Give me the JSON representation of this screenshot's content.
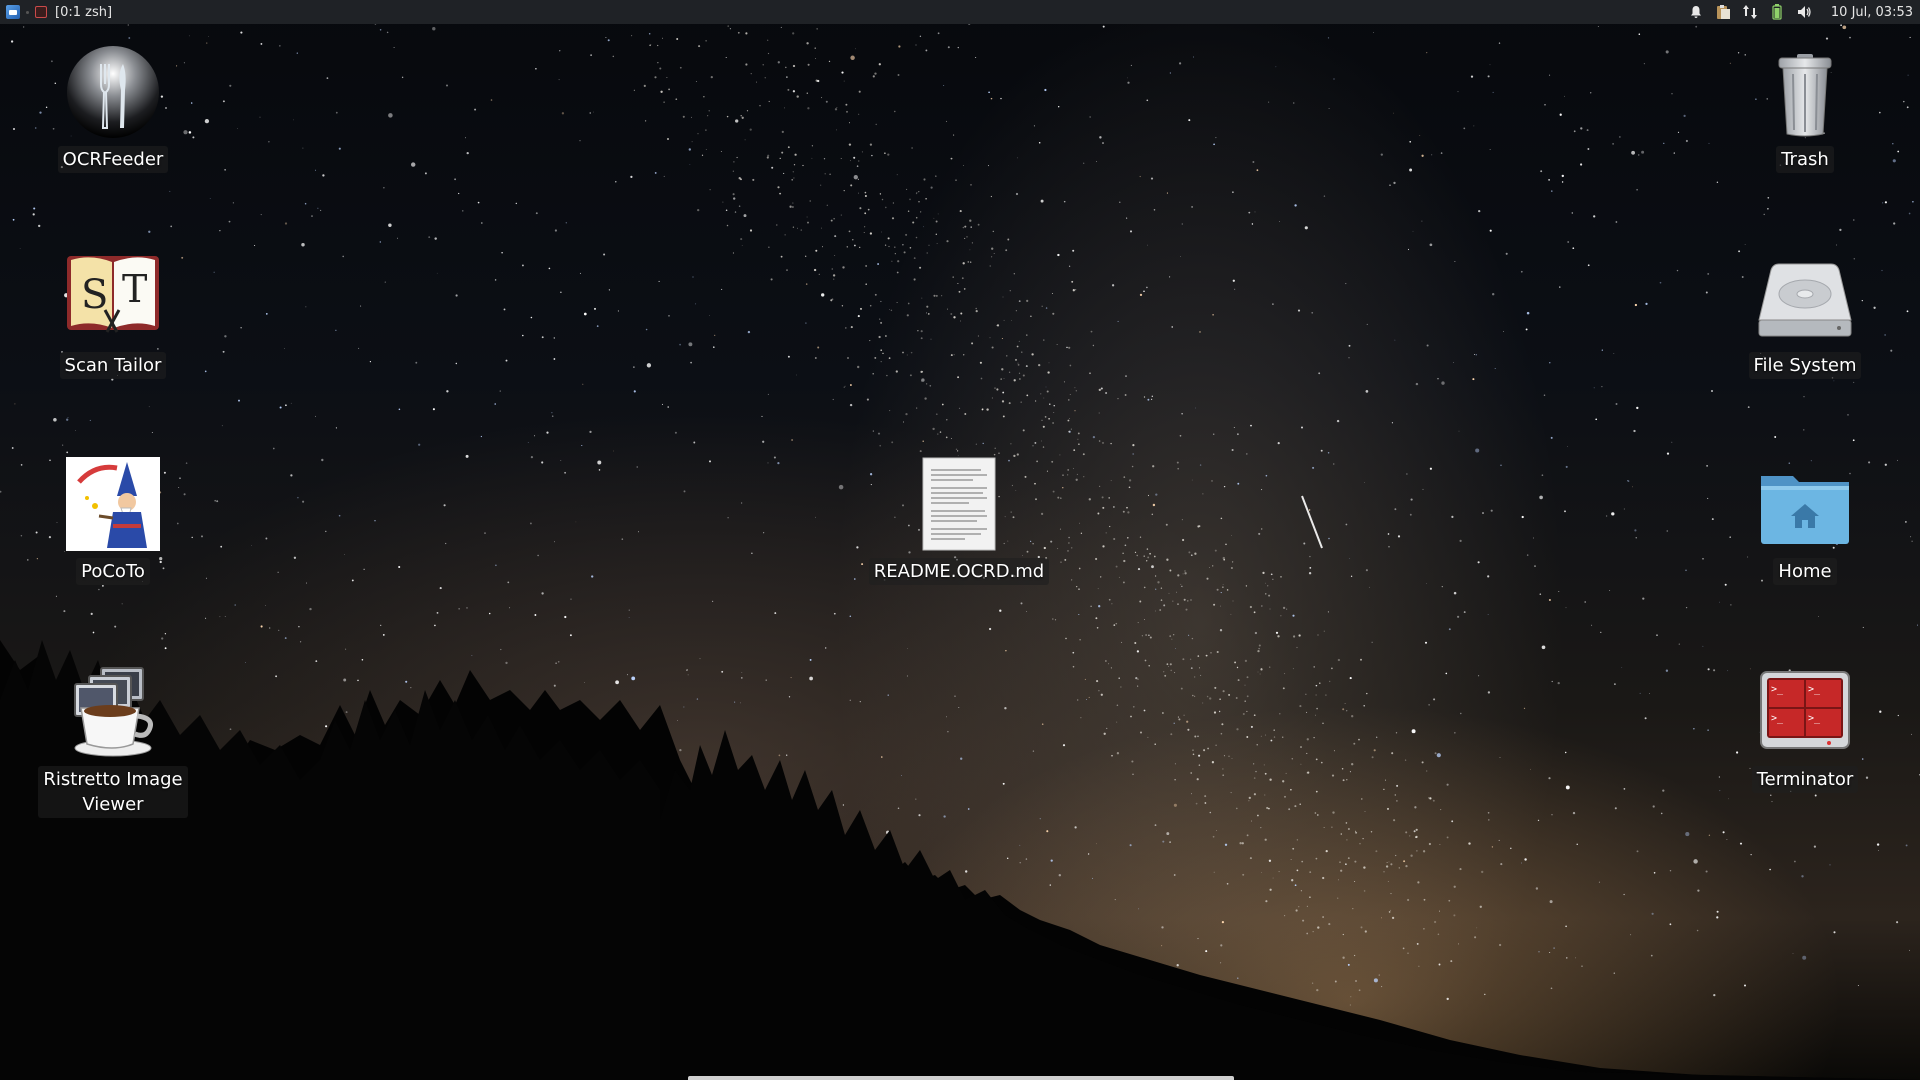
{
  "panel": {
    "menu_icon": "whisker-menu-icon",
    "task_icon": "terminal-task-icon",
    "task_label": "[0:1 zsh]",
    "tray_icons": [
      "bell-icon",
      "clipboard-icon",
      "network-arrows-icon",
      "battery-icon",
      "volume-icon"
    ],
    "clock": "10 Jul, 03:53"
  },
  "desktop": {
    "left_icons": [
      {
        "label": "OCRFeeder",
        "icon": "ocrfeeder-icon"
      },
      {
        "label": "Scan Tailor",
        "icon": "scan-tailor-icon"
      },
      {
        "label": "PoCoTo",
        "icon": "imagemagick-wizard-icon"
      },
      {
        "label": "Ristretto Image Viewer",
        "icon": "coffee-cup-icon"
      }
    ],
    "center_icons": [
      {
        "label": "README.OCRD.md",
        "icon": "text-document-icon"
      }
    ],
    "right_icons": [
      {
        "label": "Trash",
        "icon": "trash-icon"
      },
      {
        "label": "File System",
        "icon": "hard-drive-icon"
      },
      {
        "label": "Home",
        "icon": "home-folder-icon"
      },
      {
        "label": "Terminator",
        "icon": "terminator-icon"
      }
    ]
  },
  "colors": {
    "panel_bg": "#1f2226",
    "label_bg": "rgba(30,30,30,0.62)",
    "terminator_red": "#c62828",
    "folder_blue": "#5aa8d8"
  }
}
